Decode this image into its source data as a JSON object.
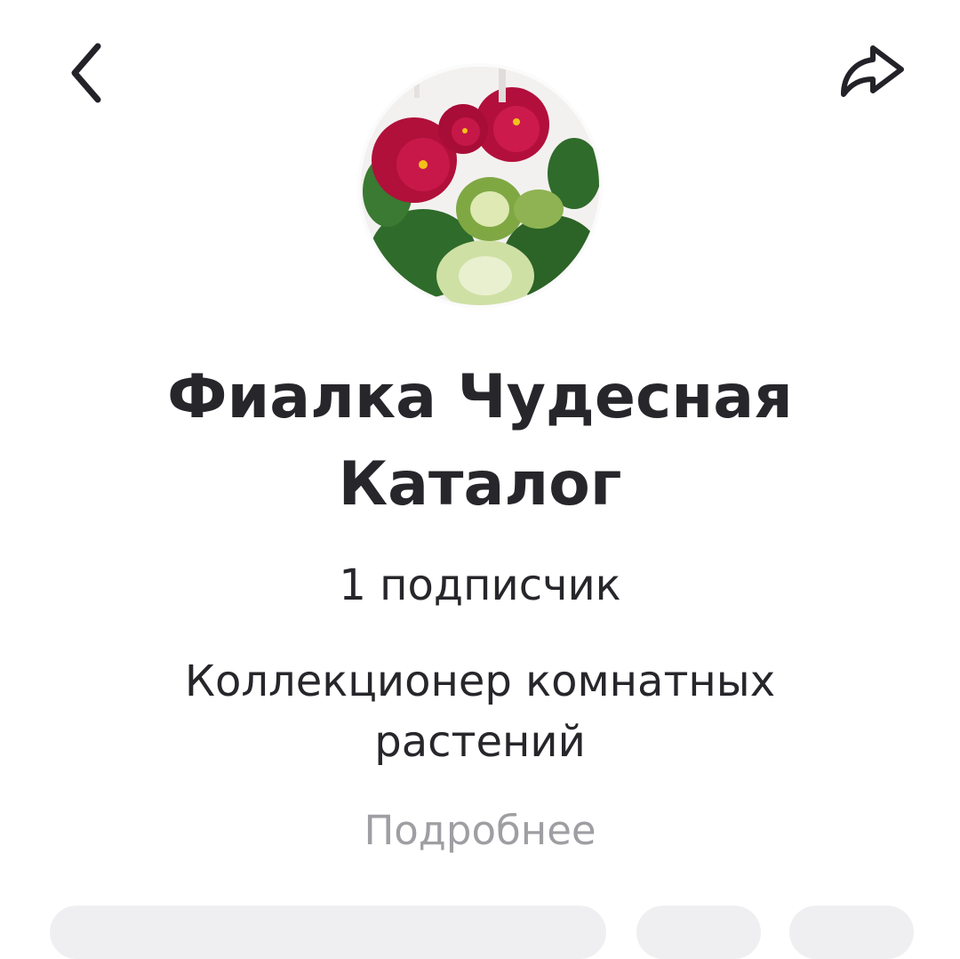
{
  "header": {
    "back_icon": "chevron-left-icon",
    "share_icon": "share-arrow-icon"
  },
  "profile": {
    "avatar_description": "violet-flower-photo",
    "title_line1": "Фиалка Чудесная",
    "title_line2": "Каталог",
    "subscribers_count": "1",
    "subscribers_label": "подписчик",
    "description_line1": "Коллекционер комнатных",
    "description_line2": "растений",
    "more_link": "Подробнее"
  },
  "colors": {
    "text": "#26262b",
    "muted": "#9e9ea3",
    "pill": "#efeff1",
    "flower": "#b0103a"
  }
}
